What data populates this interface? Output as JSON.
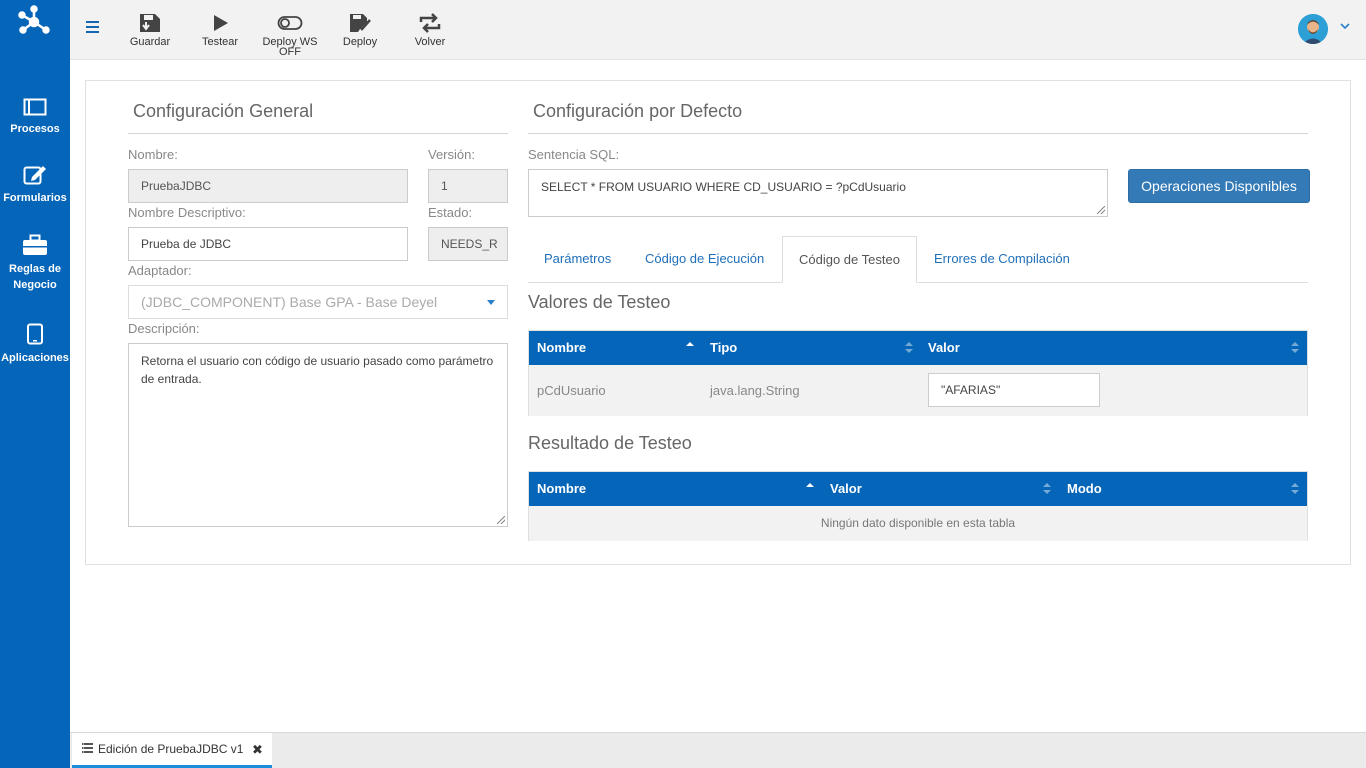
{
  "colors": {
    "sidebar": "#0565b8",
    "primary_button": "#337ab7",
    "table_header": "#0565b8",
    "active_tab_underline": "#1b8fdb"
  },
  "sidebar": {
    "logo_icon": "network-logo-icon",
    "items": [
      {
        "label": "Procesos",
        "icon": "window-icon"
      },
      {
        "label": "Formularios",
        "icon": "edit-icon"
      },
      {
        "label": "Reglas de Negocio",
        "icon": "briefcase-icon"
      },
      {
        "label": "Aplicaciones",
        "icon": "tablet-icon"
      }
    ]
  },
  "toolbar": {
    "menu_icon": "hamburger-icon",
    "buttons": [
      {
        "label": "Guardar",
        "icon": "save-icon"
      },
      {
        "label": "Testear",
        "icon": "play-icon"
      },
      {
        "label": "Deploy WS OFF",
        "icon": "toggle-off-icon"
      },
      {
        "label": "Deploy",
        "icon": "deploy-icon"
      },
      {
        "label": "Volver",
        "icon": "retweet-icon"
      }
    ],
    "user_menu_icon": "chevron-down-icon"
  },
  "general": {
    "title": "Configuración General",
    "nombre_label": "Nombre:",
    "nombre_value": "PruebaJDBC",
    "version_label": "Versión:",
    "version_value": "1",
    "nombre_desc_label": "Nombre Descriptivo:",
    "nombre_desc_value": "Prueba de JDBC",
    "estado_label": "Estado:",
    "estado_value": "NEEDS_R",
    "adaptador_label": "Adaptador:",
    "adaptador_value": "(JDBC_COMPONENT) Base GPA - Base Deyel",
    "descripcion_label": "Descripción:",
    "descripcion_value": "Retorna el usuario con código de usuario pasado como parámetro de entrada."
  },
  "defaults": {
    "title": "Configuración por Defecto",
    "sql_label": "Sentencia SQL:",
    "sql_value": "SELECT * FROM USUARIO WHERE CD_USUARIO = ?pCdUsuario",
    "ops_button": "Operaciones Disponibles"
  },
  "tabs": [
    {
      "label": "Parámetros"
    },
    {
      "label": "Código de Ejecución"
    },
    {
      "label": "Código de Testeo",
      "active": true
    },
    {
      "label": "Errores de Compilación"
    }
  ],
  "test_values": {
    "title": "Valores de Testeo",
    "columns": [
      "Nombre",
      "Tipo",
      "Valor"
    ],
    "rows": [
      {
        "nombre": "pCdUsuario",
        "tipo": "java.lang.String",
        "valor": "\"AFARIAS\""
      }
    ]
  },
  "test_results": {
    "title": "Resultado de Testeo",
    "columns": [
      "Nombre",
      "Valor",
      "Modo"
    ],
    "empty_message": "Ningún dato disponible en esta tabla"
  },
  "bottom_tab": {
    "label": "Edición de PruebaJDBC v1",
    "icon": "list-icon",
    "close_icon": "close-icon"
  }
}
